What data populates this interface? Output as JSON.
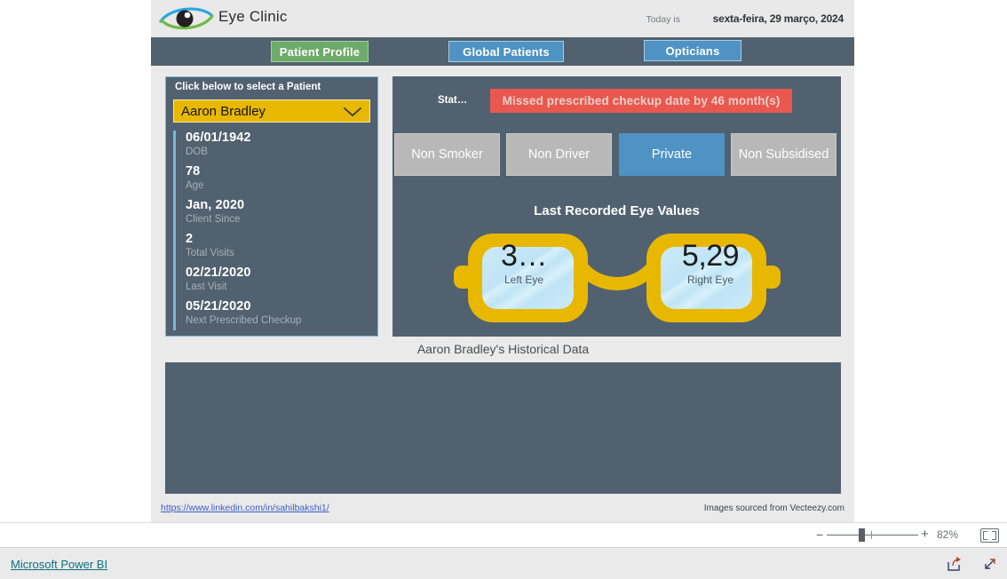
{
  "report": {
    "brand": {
      "logo_icon": "eye-logo-icon",
      "title": "Eye Clinic",
      "today_label": "Today is",
      "today_value": "sexta-feira, 29 março, 2024"
    },
    "tabs": [
      {
        "label": "Patient Profile",
        "state": "active",
        "color": "#6dab6a"
      },
      {
        "label": "Global Patients",
        "state": "inactive",
        "color": "#4e93c4"
      },
      {
        "label": "Opticians",
        "state": "inactive",
        "color": "#4e93c4"
      }
    ],
    "patient_panel": {
      "heading": "Click below to select a Patient",
      "selected_patient": "Aaron Bradley",
      "dropdown_icon": "chevron-down-icon",
      "stats": [
        {
          "value": "06/01/1942",
          "label": "DOB"
        },
        {
          "value": "78",
          "label": "Age"
        },
        {
          "value": "Jan, 2020",
          "label": "Client Since"
        },
        {
          "value": "2",
          "label": "Total Visits"
        },
        {
          "value": "02/21/2020",
          "label": "Last Visit"
        },
        {
          "value": "05/21/2020",
          "label": "Next Prescribed Checkup"
        }
      ]
    },
    "main_card": {
      "status_label": "Stat…",
      "status_banner": "Missed prescribed checkup date by 46 month(s)",
      "status_color": "#e8584f",
      "attributes": [
        {
          "label": "Non Smoker",
          "selected": false
        },
        {
          "label": "Non Driver",
          "selected": false
        },
        {
          "label": "Private",
          "selected": true
        },
        {
          "label": "Non Subsidised",
          "selected": false
        }
      ],
      "eye_values": {
        "title": "Last Recorded Eye Values",
        "left": {
          "value": "3…",
          "caption": "Left Eye"
        },
        "right": {
          "value": "5,29",
          "caption": "Right Eye"
        },
        "frame_color": "#e8b800",
        "lens_color": "#bfe4f5"
      }
    },
    "historical": {
      "title": "Aaron Bradley's Historical Data"
    },
    "footer": {
      "link": "https://www.linkedin.com/in/sahilbakshi1/",
      "credit": "Images sourced from Vecteezy.com"
    }
  },
  "chrome": {
    "zoom": {
      "minus_label": "−",
      "plus_label": "+",
      "percent": "82%",
      "fit_icon": "fit-to-page-icon"
    },
    "bottom": {
      "product_link": "Microsoft Power BI",
      "share_icon": "share-icon",
      "expand_icon": "full-screen-icon"
    }
  }
}
